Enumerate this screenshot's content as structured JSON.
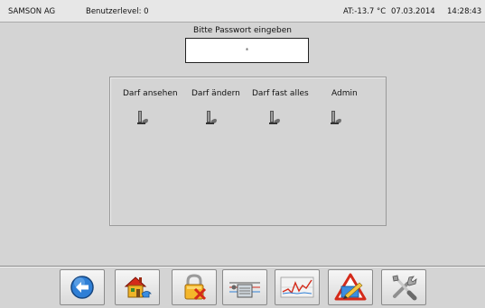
{
  "status_bar": {
    "company": "SAMSON AG",
    "user_level": "Benutzerlevel: 0",
    "outdoor_temperature": "AT:-13.7 °C",
    "date": "07.03.2014",
    "time": "14:28:43"
  },
  "login": {
    "prompt": "Bitte Passwort eingeben",
    "password_value": "*"
  },
  "access_levels": [
    {
      "label": "Darf ansehen"
    },
    {
      "label": "Darf ändern"
    },
    {
      "label": "Darf fast alles"
    },
    {
      "label": "Admin"
    }
  ],
  "toolbar": {
    "buttons": [
      {
        "icon": "back-arrow-icon"
      },
      {
        "icon": "home-icon"
      },
      {
        "icon": "lock-icon"
      },
      {
        "icon": "plant-schematic-icon"
      },
      {
        "icon": "trend-chart-icon"
      },
      {
        "icon": "alarm-warning-icon"
      },
      {
        "icon": "tools-icon"
      }
    ]
  },
  "colors": {
    "background": "#d4d4d4",
    "status_bar": "#e7e7e7",
    "accent_blue": "#2f7fd6",
    "alarm_red": "#d42a1a"
  }
}
